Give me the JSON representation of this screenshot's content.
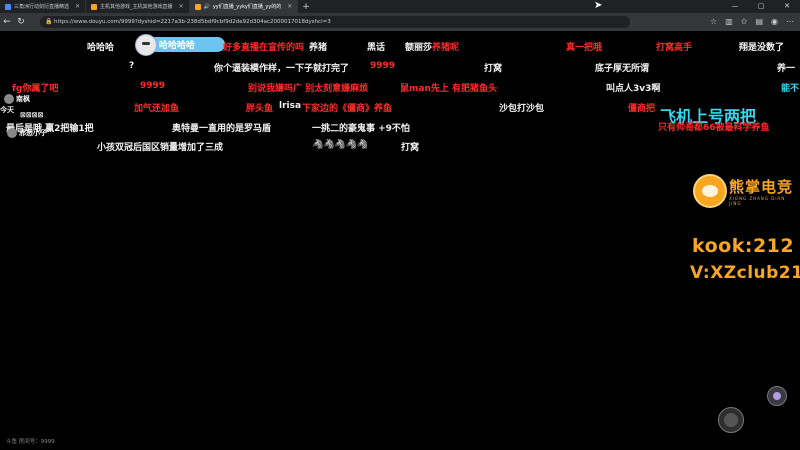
{
  "browser": {
    "tabs": [
      {
        "label": "三角洲行动剑衍直播精选",
        "color": "#4a8cf7"
      },
      {
        "label": "主机其他游戏_主机其他游戏直播",
        "color": "#f6a623"
      },
      {
        "label": "yy们直播_yyky们直播_yy的的",
        "color": "#f6a623"
      }
    ],
    "new_tab": "+",
    "url": "https://www.douyu.com/9999?dyshid=2217a3b-238d5bdf9cbf9d2de92d304ac2000017018dyshci=3",
    "window_controls": [
      "—",
      "▢",
      "✕"
    ]
  },
  "danmaku": [
    {
      "text": "哈哈哈",
      "color": "w"
    },
    {
      "text": "好多直播在宣传的吗",
      "color": "r"
    },
    {
      "text": "养猪",
      "color": "w"
    },
    {
      "text": "黑话",
      "color": "w"
    },
    {
      "text": "额丽莎",
      "color": "w"
    },
    {
      "text": "养猪呢",
      "color": "r"
    },
    {
      "text": "真一把哦",
      "color": "r"
    },
    {
      "text": "打窝高手",
      "color": "r"
    },
    {
      "text": "翔是没数了",
      "color": "w"
    },
    {
      "text": "?",
      "color": "w"
    },
    {
      "text": "你个逼装模作样，一下子就打完了",
      "color": "w"
    },
    {
      "text": "9999",
      "color": "r"
    },
    {
      "text": "打窝",
      "color": "w"
    },
    {
      "text": "底子厚无所谓",
      "color": "w"
    },
    {
      "text": "养一",
      "color": "w"
    },
    {
      "text": "fg你属了吧",
      "color": "r"
    },
    {
      "text": "9999",
      "color": "r"
    },
    {
      "text": "别说我嫌吗广 别太刻意嫌麻烦",
      "color": "r"
    },
    {
      "text": "鼠man先上 有肥猪鱼头",
      "color": "r"
    },
    {
      "text": "叫点人3v3啊",
      "color": "w"
    },
    {
      "text": "能不",
      "color": "c"
    },
    {
      "text": "南枫",
      "color": "w"
    },
    {
      "text": "加气还加鱼",
      "color": "r"
    },
    {
      "text": "胖头鱼",
      "color": "r"
    },
    {
      "text": "lrisa",
      "color": "w"
    },
    {
      "text": "下家边的《僵商》养鱼",
      "color": "r"
    },
    {
      "text": "沙包打沙包",
      "color": "w"
    },
    {
      "text": "僵商把",
      "color": "r"
    },
    {
      "text": "今天",
      "color": "w"
    },
    {
      "text": "最后是哦 赢2把输1把",
      "color": "w"
    },
    {
      "text": "奥特曼一直用的是罗马盾",
      "color": "w"
    },
    {
      "text": "一挑二的豪鬼事 +9不怕",
      "color": "w"
    },
    {
      "text": "小孩双冠后国区销量增加了三成",
      "color": "w"
    },
    {
      "text": "🦓🦓🦓🦓🦓",
      "color": "w"
    },
    {
      "text": "打窝",
      "color": "w"
    },
    {
      "text": "邪恶小子",
      "color": "w"
    },
    {
      "text": "⊠⊠⊠⊠",
      "color": "w"
    },
    {
      "text": "哈哈哈哈",
      "color": "w"
    }
  ],
  "overlay": {
    "big_cyan": "飞机上号两把",
    "red_line": "只有帅哥都66被最科学养鱼",
    "brand": "熊掌电竞",
    "brand_sub": "XIONG ZHANG DIAN JING",
    "kook": "kook:212",
    "wechat": "V:XZclub212"
  },
  "bottom": {
    "info": "斗鱼 房间号：9999"
  }
}
